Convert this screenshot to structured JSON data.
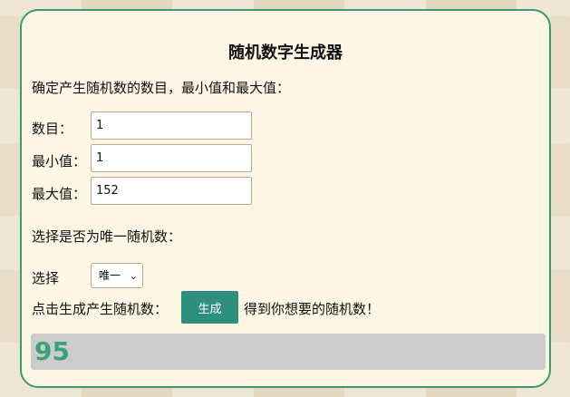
{
  "title": "随机数字生成器",
  "intro": "确定产生随机数的数目，最小值和最大值：",
  "count": {
    "label": "数目：",
    "value": "1"
  },
  "min": {
    "label": "最小值：",
    "value": "1"
  },
  "max": {
    "label": "最大值：",
    "value": "152"
  },
  "unique_prompt": "选择是否为唯一随机数：",
  "select": {
    "label": "选择",
    "value": "唯一",
    "icon": "chevron-down-icon"
  },
  "generate": {
    "prompt": "点击生成产生随机数：",
    "button": "生成",
    "suffix": "得到你想要的随机数！"
  },
  "result": "95",
  "colors": {
    "accent": "#3a9a72",
    "button": "#2f8f7f",
    "result_text": "#3aa179",
    "result_bg": "#cccccc"
  }
}
